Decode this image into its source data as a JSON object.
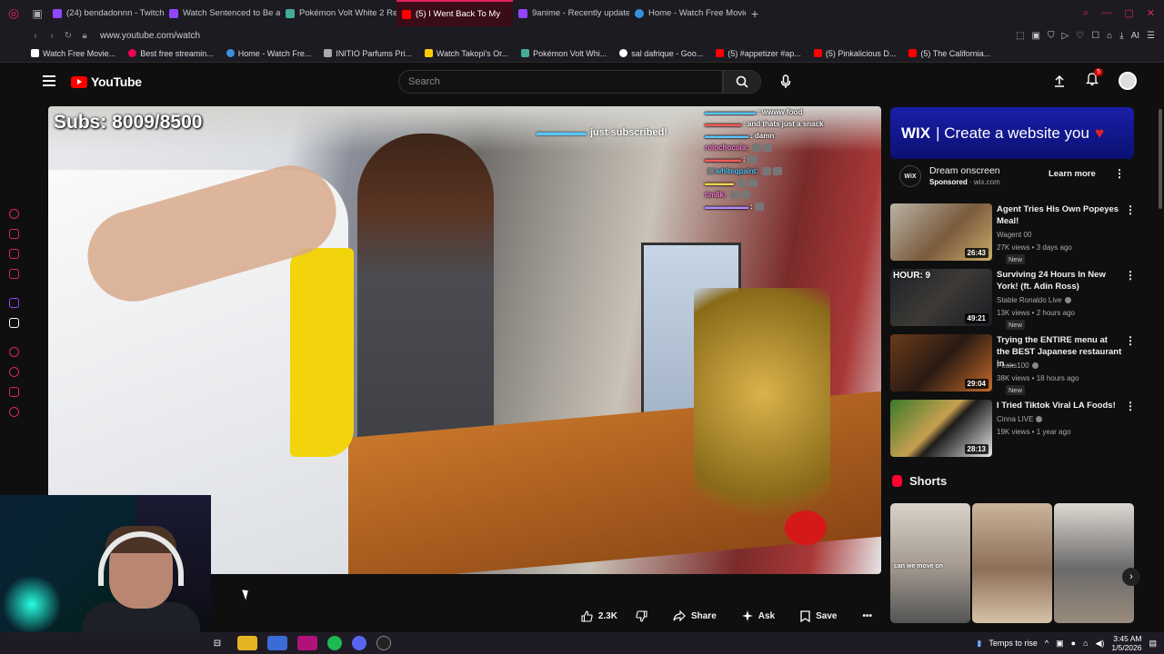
{
  "browser": {
    "tabs": [
      {
        "label": "(24) bendadonnn - Twitch",
        "color": "#9146ff"
      },
      {
        "label": "Watch Sentenced to Be a",
        "color": "#9146ff"
      },
      {
        "label": "Pokémon Volt White 2 Re",
        "color": "#4a9"
      },
      {
        "label": "(5) I Went Back To My",
        "color": "#ff0000",
        "active": true
      },
      {
        "label": "9anime - Recently update",
        "color": "#9146ff"
      },
      {
        "label": "Home - Watch Free Movie",
        "color": "#3a8fd9"
      }
    ],
    "new_tab": "+",
    "url": "www.youtube.com/watch",
    "extensions": [
      "AI"
    ],
    "bookmarks": [
      {
        "label": "Watch Free Movie...",
        "color": "#fff"
      },
      {
        "label": "Best free streamin...",
        "color": "#e05"
      },
      {
        "label": "Home - Watch Fre...",
        "color": "#3a8fd9"
      },
      {
        "label": "INITIO Parfums Pri...",
        "color": "#aaa"
      },
      {
        "label": "Watch Takopi's Or...",
        "color": "#fc0"
      },
      {
        "label": "Pokémon Volt Whi...",
        "color": "#4a9"
      },
      {
        "label": "sal dafrique - Goo...",
        "color": "#fff"
      },
      {
        "label": "(5) #appetizer #ap...",
        "color": "#f00"
      },
      {
        "label": "(5) Pinkalicious D...",
        "color": "#f00"
      },
      {
        "label": "(5) The California...",
        "color": "#f00"
      }
    ]
  },
  "youtube": {
    "logo": "YouTube",
    "search_placeholder": "Search",
    "notifications": "5"
  },
  "video": {
    "subs_overlay": "Subs: 8009/8500",
    "just_subscribed": "just subscribed!",
    "chat": [
      {
        "user": "",
        "user_color": "#57c7ff",
        "msg": ": wwww food"
      },
      {
        "user": "",
        "user_color": "#ff5a5a",
        "msg": ": and thats just a snack"
      },
      {
        "user": "",
        "user_color": "#57c7ff",
        "msg": ": damn"
      },
      {
        "user": "rolochocola:",
        "user_color": "#ff7bd8",
        "msg": ""
      },
      {
        "user": "",
        "user_color": "#ff5a5a",
        "msg": ":"
      },
      {
        "user": "whiteqpaint:",
        "user_color": "#57c7ff",
        "msg": ""
      },
      {
        "user": "",
        "user_color": "#ffd34e",
        "msg": ""
      },
      {
        "user": "tim8k:",
        "user_color": "#ff7bd8",
        "msg": ""
      },
      {
        "user": "",
        "user_color": "#b08aff",
        "msg": ":"
      }
    ]
  },
  "actions": {
    "likes": "2.3K",
    "share": "Share",
    "ask": "Ask",
    "save": "Save"
  },
  "sidebar": {
    "ad": {
      "banner_brand": "WIX",
      "banner_text": "| Create a website you",
      "title": "Dream onscreen",
      "sponsored": "Sponsored",
      "domain": "wix.com",
      "cta": "Learn more",
      "logo": "WiX"
    },
    "videos": [
      {
        "title": "Agent Tries His Own Popeyes Meal!",
        "channel": "Wagent 00",
        "stats": "27K views • 3 days ago",
        "badge": "New",
        "duration": "26:43",
        "verified": false
      },
      {
        "title": "Surviving 24 Hours In New York! (ft. Adin Ross)",
        "channel": "Stable Ronaldo Live",
        "stats": "13K views • 2 hours ago",
        "badge": "New",
        "duration": "49:21",
        "verified": true,
        "thumb_text": "HOUR: 9"
      },
      {
        "title": "Trying the ENTIRE menu at the BEST Japanese restaurant in ...",
        "channel": "Peaks100",
        "stats": "38K views • 18 hours ago",
        "badge": "New",
        "duration": "29:04",
        "verified": true
      },
      {
        "title": "I Tried Tiktok Viral LA Foods!",
        "channel": "Cinna LIVE",
        "stats": "19K views • 1 year ago",
        "badge": "",
        "duration": "28:13",
        "verified": true
      }
    ],
    "shorts_heading": "Shorts",
    "shorts": [
      {
        "overlay": "can we move on"
      },
      {
        "overlay": ""
      },
      {
        "overlay": ""
      }
    ]
  },
  "taskbar": {
    "weather": "Temps to rise",
    "time": "3:45 AM",
    "date": "1/5/2026"
  }
}
